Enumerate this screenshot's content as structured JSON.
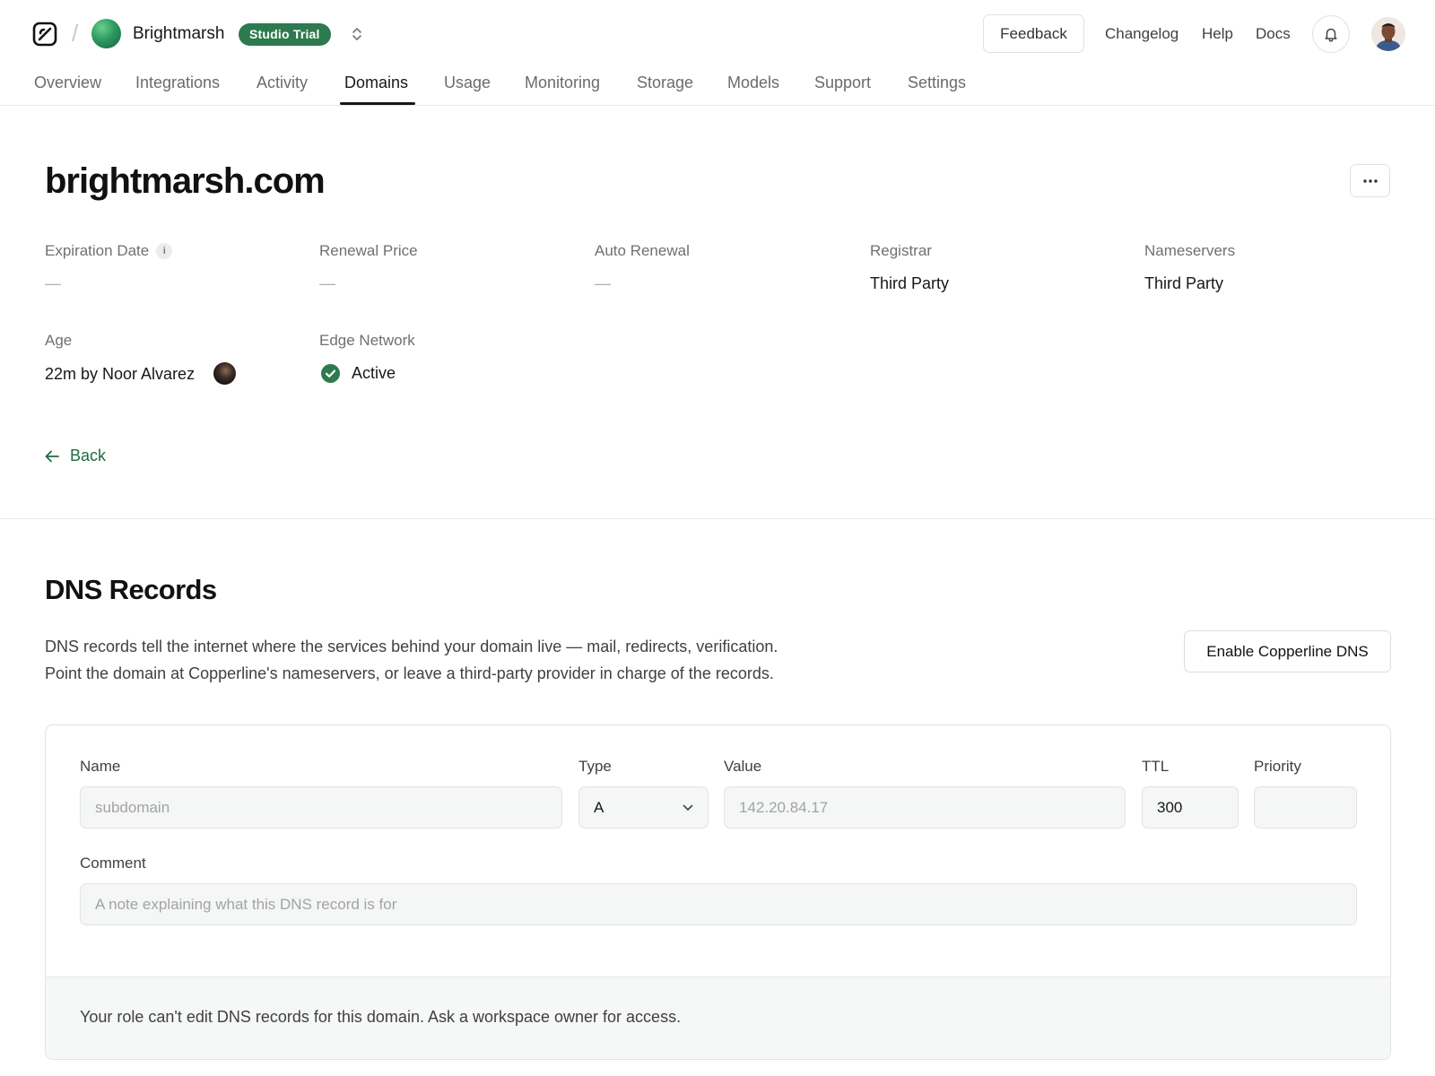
{
  "header": {
    "team_name": "Brightmarsh",
    "trial_badge": "Studio Trial",
    "feedback_label": "Feedback",
    "links": [
      "Changelog",
      "Help",
      "Docs"
    ]
  },
  "tabs": [
    "Overview",
    "Integrations",
    "Activity",
    "Domains",
    "Usage",
    "Monitoring",
    "Storage",
    "Models",
    "Support",
    "Settings"
  ],
  "active_tab": "Domains",
  "domain": {
    "title": "brightmarsh.com",
    "expiration_label": "Expiration Date",
    "expiration_value": "—",
    "renewal_label": "Renewal Price",
    "renewal_value": "—",
    "auto_renewal_label": "Auto Renewal",
    "auto_renewal_value": "—",
    "registrar_label": "Registrar",
    "registrar_value": "Third Party",
    "nameservers_label": "Nameservers",
    "nameservers_value": "Third Party",
    "age_label": "Age",
    "age_value": "22m by Noor Alvarez",
    "edge_label": "Edge Network",
    "edge_value": "Active",
    "back_label": "Back"
  },
  "dns": {
    "title": "DNS Records",
    "desc_line1": "DNS records tell the internet where the services behind your domain live — mail, redirects, verification.",
    "desc_line2": "Point the domain at Copperline's nameservers, or leave a third-party provider in charge of the records.",
    "enable_label": "Enable Copperline DNS",
    "form": {
      "name_label": "Name",
      "name_placeholder": "subdomain",
      "type_label": "Type",
      "type_value": "A",
      "value_label": "Value",
      "value_placeholder": "142.20.84.17",
      "ttl_label": "TTL",
      "ttl_value": "300",
      "priority_label": "Priority",
      "comment_label": "Comment",
      "comment_placeholder": "A note explaining what this DNS record is for"
    },
    "notice": "Your role can't edit DNS records for this domain. Ask a workspace owner for access."
  },
  "colors": {
    "brand_green": "#2d7a4f",
    "link_green": "#1f6b45",
    "text": "#171717",
    "muted": "#707070"
  },
  "icons": [
    "logo-icon",
    "chevron-updown-icon",
    "bell-icon",
    "info-icon",
    "check-circle-icon",
    "arrow-left-icon",
    "more-horizontal-icon",
    "chevron-down-icon"
  ]
}
